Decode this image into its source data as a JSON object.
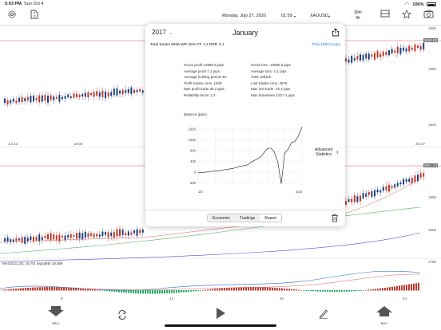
{
  "status_bar": {
    "time": "5:03 PM",
    "date": "Sun Oct 4",
    "battery": "100%"
  },
  "toolbar": {
    "date": "Monday, July 27, 2020",
    "clock": "01:59",
    "symbol": "XAUUSD",
    "timeframe_top": "30m",
    "timeframe_bottom": "4h"
  },
  "chart": {
    "price_labels": [
      "1900",
      "1860",
      "1840",
      "1900",
      "1850",
      "1800",
      "1750"
    ],
    "price_badges": [
      "1936.00",
      "1904.60"
    ],
    "top_time_labels": [
      "Jul 22",
      "18:00",
      "Jul 27"
    ],
    "bottom_time_labels": [
      "8",
      "14",
      "20",
      "24"
    ],
    "macd_label": "MACD(12,26; 19,70) Signal(9) 18.589"
  },
  "popup": {
    "year": "2017",
    "month": "January",
    "summary": "Total trades 6865   WR 26%   PF 1.2   RRR 3.4",
    "total": "Total 1680.6 pips",
    "stats_left": [
      "Gross profit 12586.5 pips",
      "Average profit 7.2 pips",
      "Average holding period 4m",
      "Profit trades cons. 1629",
      "Max profit trade 35.2 pips",
      "Reliability factor 1.3"
    ],
    "stats_right": [
      "Gross loss -10905.9 pips",
      "Average loss -2.1 pips",
      "Total 19d11h",
      "Lost trades cons. 4978",
      "Max lost trade -15.4 pips",
      "Max drawdown 1327.4 pips"
    ],
    "balance_label": "Balance (pips)",
    "advanced_label_1": "Advanced",
    "advanced_label_2": "Statistics",
    "tabs": [
      "Economic",
      "Tradings",
      "Report"
    ],
    "active_tab": "Report",
    "chart_data": {
      "type": "line",
      "title": "Balance (pips)",
      "y_ticks": [
        1600,
        1200,
        800,
        400,
        0,
        -400
      ],
      "ylim": [
        -500,
        1750
      ],
      "x_labels": [
        "1st",
        "31st"
      ],
      "x": [
        0,
        2,
        4,
        6,
        8,
        10,
        12,
        14,
        16,
        18,
        20,
        21,
        22,
        23,
        24,
        25,
        26,
        27,
        28,
        29,
        30
      ],
      "values": [
        -20,
        0,
        40,
        60,
        100,
        140,
        220,
        260,
        420,
        560,
        880,
        900,
        760,
        380,
        -420,
        700,
        860,
        1100,
        1150,
        1360,
        1680
      ]
    }
  },
  "bottom_bar": {
    "sell_label": "SELL",
    "buy_label": "BUY"
  }
}
